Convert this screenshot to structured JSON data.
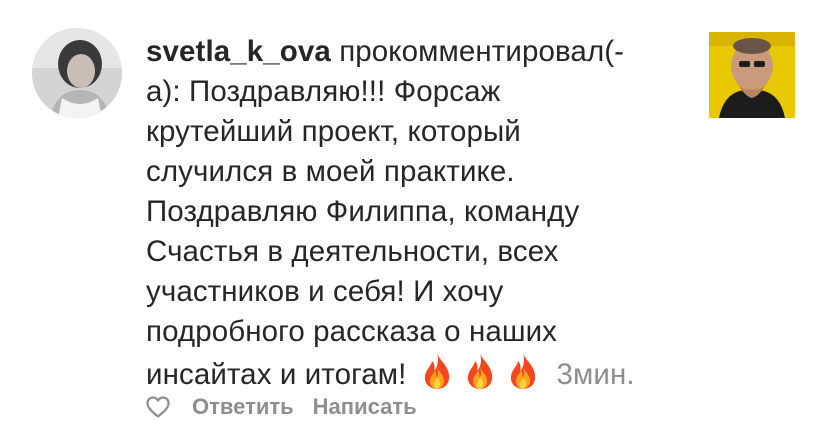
{
  "comment": {
    "username": "svetla_k_ova",
    "text_lines": [
      " прокомментировал(-",
      "а): Поздравляю!!! Форсаж",
      "крутейший проект, который",
      "случился в моей практике.",
      "Поздравляю Филиппа, команду",
      "Счастья в деятельности, всех",
      "участников и себя! И хочу",
      "подробного рассказа о наших",
      "инсайтах и итогам!"
    ],
    "emoji": [
      "fire-icon",
      "fire-icon",
      "fire-icon"
    ],
    "time": "3мин."
  },
  "actions": {
    "reply_label": "Ответить",
    "message_label": "Написать"
  },
  "colors": {
    "text": "#262626",
    "secondary": "#8e8e8e",
    "thumb_background": "#e8c800"
  }
}
